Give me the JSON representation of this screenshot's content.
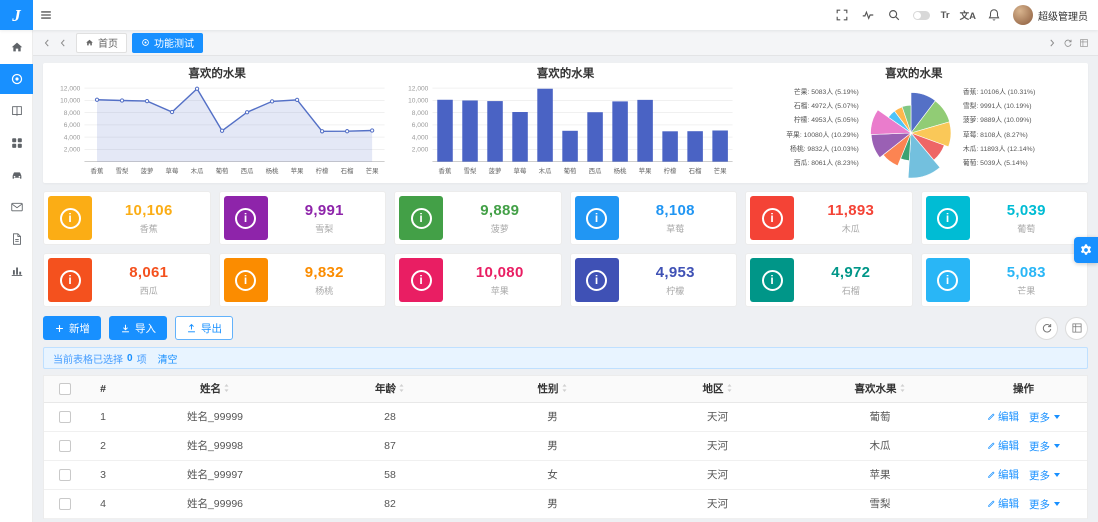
{
  "app": {
    "logo_text": "J",
    "user": "超级管理员",
    "accent": "#1890ff"
  },
  "topbar": {
    "translate_label": "Tr",
    "lang_label": "文A"
  },
  "tabbar": {
    "tabs": [
      {
        "label": "首页"
      },
      {
        "label": "功能测试"
      }
    ]
  },
  "chart_data": [
    {
      "type": "line",
      "title": "喜欢的水果",
      "categories": [
        "香蕉",
        "雪梨",
        "菠萝",
        "草莓",
        "木瓜",
        "葡萄",
        "西瓜",
        "杨桃",
        "苹果",
        "柠檬",
        "石榴",
        "芒果"
      ],
      "values": [
        10106,
        9991,
        9889,
        8108,
        11893,
        5039,
        8061,
        9832,
        10080,
        4953,
        4972,
        5083
      ],
      "ylim": [
        0,
        12000
      ],
      "ytick_interval": 2000,
      "color": "#5470c6",
      "area": true,
      "grid": true,
      "legend": "off"
    },
    {
      "type": "bar",
      "title": "喜欢的水果",
      "categories": [
        "香蕉",
        "雪梨",
        "菠萝",
        "草莓",
        "木瓜",
        "葡萄",
        "西瓜",
        "杨桃",
        "苹果",
        "柠檬",
        "石榴",
        "芒果"
      ],
      "values": [
        10106,
        9991,
        9889,
        8108,
        11893,
        5039,
        8061,
        9832,
        10080,
        4953,
        4972,
        5083
      ],
      "ylim": [
        0,
        12000
      ],
      "ytick_interval": 2000,
      "color": "#4a63c4",
      "grid": true,
      "legend": "off"
    },
    {
      "type": "pie",
      "rose": true,
      "title": "喜欢的水果",
      "unit": "人",
      "labels": [
        "香蕉",
        "雪梨",
        "菠萝",
        "草莓",
        "木瓜",
        "葡萄",
        "西瓜",
        "杨桃",
        "苹果",
        "柠檬",
        "石榴",
        "芒果"
      ],
      "values": [
        10106,
        9991,
        9889,
        8108,
        11893,
        5039,
        8061,
        9832,
        10080,
        4953,
        4972,
        5083
      ],
      "percents": [
        10.31,
        10.19,
        10.09,
        8.27,
        12.14,
        5.14,
        8.23,
        10.03,
        10.29,
        5.05,
        5.07,
        5.19
      ],
      "label_columns": {
        "left": [
          "芒果: 5083人 (5.19%)",
          "石榴: 4972人 (5.07%)",
          "柠檬: 4953人 (5.05%)",
          "苹果: 10080人 (10.29%)",
          "杨桃: 9832人 (10.03%)",
          "西瓜: 8061人 (8.23%)"
        ],
        "right": [
          "香蕉: 10106人 (10.31%)",
          "雪梨: 9991人 (10.19%)",
          "菠萝: 9889人 (10.09%)",
          "草莓: 8108人 (8.27%)",
          "木瓜: 11893人 (12.14%)",
          "葡萄: 5039人 (5.14%)"
        ]
      },
      "palette": [
        "#5470c6",
        "#91cc75",
        "#fac858",
        "#ee6666",
        "#73c0de",
        "#3ba272",
        "#fc8452",
        "#9a60b4",
        "#ea7ccc",
        "#4fc3f7",
        "#ffb74d",
        "#81c784"
      ]
    }
  ],
  "cards": [
    {
      "value": "10,106",
      "label": "香蕉",
      "color": "#fbad15"
    },
    {
      "value": "9,991",
      "label": "雪梨",
      "color": "#8e24aa"
    },
    {
      "value": "9,889",
      "label": "菠萝",
      "color": "#43a047"
    },
    {
      "value": "8,108",
      "label": "草莓",
      "color": "#2196f3"
    },
    {
      "value": "11,893",
      "label": "木瓜",
      "color": "#f44336"
    },
    {
      "value": "5,039",
      "label": "葡萄",
      "color": "#00bcd4"
    },
    {
      "value": "8,061",
      "label": "西瓜",
      "color": "#f4511e"
    },
    {
      "value": "9,832",
      "label": "杨桃",
      "color": "#fb8c00"
    },
    {
      "value": "10,080",
      "label": "苹果",
      "color": "#e91e63"
    },
    {
      "value": "4,953",
      "label": "柠檬",
      "color": "#3f51b5"
    },
    {
      "value": "4,972",
      "label": "石榴",
      "color": "#009688"
    },
    {
      "value": "5,083",
      "label": "芒果",
      "color": "#29b6f6"
    }
  ],
  "toolbar": {
    "add": "新增",
    "import": "导入",
    "export": "导出"
  },
  "selection_bar": {
    "prefix": "当前表格已选择",
    "count": "0",
    "suffix": "项",
    "clear": "清空"
  },
  "table": {
    "columns": [
      {
        "label": "#",
        "sortable": false
      },
      {
        "label": "姓名",
        "sortable": true
      },
      {
        "label": "年龄",
        "sortable": true
      },
      {
        "label": "性别",
        "sortable": true
      },
      {
        "label": "地区",
        "sortable": true
      },
      {
        "label": "喜欢水果",
        "sortable": true
      },
      {
        "label": "操作",
        "sortable": false
      }
    ],
    "rows": [
      {
        "index": "1",
        "name": "姓名_99999",
        "age": "28",
        "gender": "男",
        "region": "天河",
        "fruit": "葡萄"
      },
      {
        "index": "2",
        "name": "姓名_99998",
        "age": "87",
        "gender": "男",
        "region": "天河",
        "fruit": "木瓜"
      },
      {
        "index": "3",
        "name": "姓名_99997",
        "age": "58",
        "gender": "女",
        "region": "天河",
        "fruit": "苹果"
      },
      {
        "index": "4",
        "name": "姓名_99996",
        "age": "82",
        "gender": "男",
        "region": "天河",
        "fruit": "雪梨"
      }
    ],
    "actions": {
      "edit": "编辑",
      "more": "更多"
    }
  },
  "sidebar": {
    "items": [
      {
        "icon": "home-icon",
        "active": false
      },
      {
        "icon": "dot-circle-icon",
        "active": true
      },
      {
        "icon": "book-icon",
        "active": false
      },
      {
        "icon": "apps-icon",
        "active": false
      },
      {
        "icon": "car-icon",
        "active": false
      },
      {
        "icon": "mail-icon",
        "active": false
      },
      {
        "icon": "file-icon",
        "active": false
      },
      {
        "icon": "bar-chart-icon",
        "active": false
      }
    ]
  }
}
